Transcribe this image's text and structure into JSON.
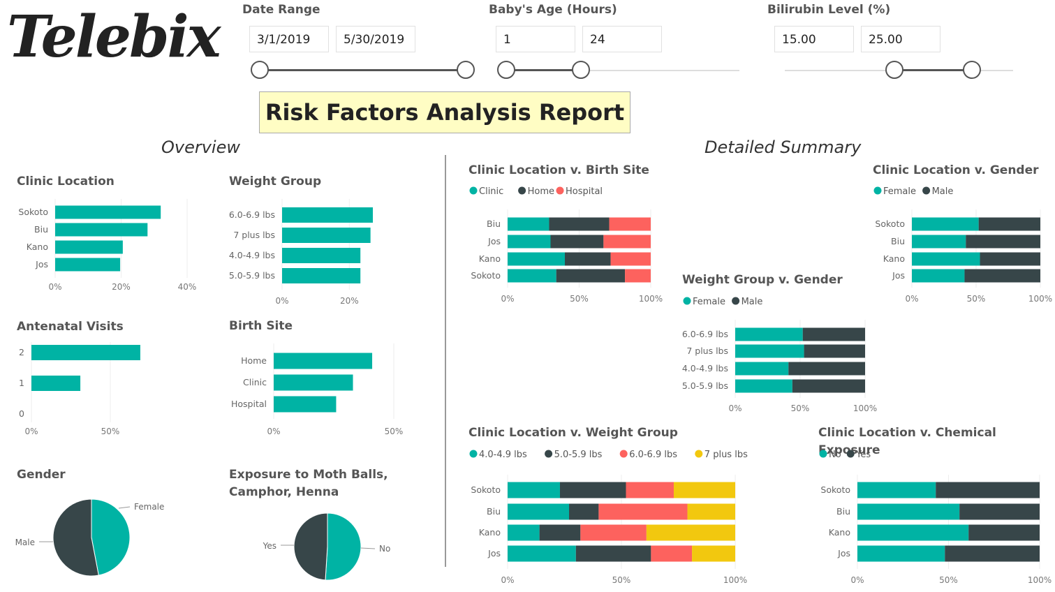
{
  "logo": {
    "text": "Telebix"
  },
  "report_title": "Risk Factors Analysis Report",
  "sections": {
    "overview": "Overview",
    "detailed": "Detailed Summary"
  },
  "slicers": {
    "date_range": {
      "title": "Date Range",
      "from": "3/1/2019",
      "to": "5/30/2019",
      "range_fraction": [
        0,
        1
      ]
    },
    "baby_age": {
      "title": "Baby's Age (Hours)",
      "from": "1",
      "to": "24",
      "range_fraction": [
        0,
        0.32
      ]
    },
    "bilirubin": {
      "title": "Bilirubin Level (%)",
      "from": "15.00",
      "to": "25.00",
      "range_fraction": [
        0.48,
        0.82
      ]
    }
  },
  "chart_data": [
    {
      "id": "clinic_location",
      "type": "bar",
      "title": "Clinic Location",
      "categories": [
        "Sokoto",
        "Biu",
        "Kano",
        "Jos"
      ],
      "values": [
        0.32,
        0.28,
        0.205,
        0.197
      ],
      "xticks": [
        {
          "v": 0,
          "label": "0%"
        },
        {
          "v": 0.2,
          "label": "20%"
        },
        {
          "v": 0.4,
          "label": "40%"
        }
      ],
      "xlim": [
        0,
        0.4
      ],
      "color": "#00b3a4"
    },
    {
      "id": "weight_group",
      "type": "bar",
      "title": "Weight Group",
      "categories": [
        "6.0-6.9 lbs",
        "7 plus lbs",
        "4.0-4.9 lbs",
        "5.0-5.9 lbs"
      ],
      "values": [
        0.27,
        0.263,
        0.233,
        0.233
      ],
      "xticks": [
        {
          "v": 0,
          "label": "0%"
        },
        {
          "v": 0.2,
          "label": "20%"
        }
      ],
      "xlim": [
        0,
        0.27
      ],
      "color": "#00b3a4"
    },
    {
      "id": "antenatal_visits",
      "type": "bar",
      "title": "Antenatal Visits",
      "categories": [
        "2",
        "1",
        "0"
      ],
      "values": [
        0.69,
        0.31,
        0
      ],
      "xticks": [
        {
          "v": 0,
          "label": "0%"
        },
        {
          "v": 0.5,
          "label": "50%"
        }
      ],
      "xlim": [
        0,
        0.5
      ],
      "color": "#00b3a4"
    },
    {
      "id": "birth_site",
      "type": "bar",
      "title": "Birth Site",
      "categories": [
        "Home",
        "Clinic",
        "Hospital"
      ],
      "values": [
        0.41,
        0.33,
        0.26
      ],
      "xticks": [
        {
          "v": 0,
          "label": "0%"
        },
        {
          "v": 0.5,
          "label": "50%"
        }
      ],
      "xlim": [
        0,
        0.5
      ],
      "color": "#00b3a4"
    },
    {
      "id": "gender",
      "type": "pie",
      "title": "Gender",
      "labels": [
        "Female",
        "Male"
      ],
      "values": [
        0.47,
        0.53
      ],
      "colors": [
        "#00b3a4",
        "#374649"
      ]
    },
    {
      "id": "exposure",
      "type": "pie",
      "title": "Exposure to Moth Balls, Camphor, Henna",
      "labels": [
        "No",
        "Yes"
      ],
      "values": [
        0.51,
        0.49
      ],
      "colors": [
        "#00b3a4",
        "#374649"
      ]
    },
    {
      "id": "clinic_v_birth_site",
      "type": "stacked_bar",
      "title": "Clinic Location v. Birth Site",
      "categories": [
        "Biu",
        "Jos",
        "Kano",
        "Sokoto"
      ],
      "series": [
        {
          "name": "Clinic",
          "color": "#00b3a4",
          "values": [
            0.29,
            0.3,
            0.4,
            0.34
          ]
        },
        {
          "name": "Home",
          "color": "#374649",
          "values": [
            0.42,
            0.37,
            0.32,
            0.48
          ]
        },
        {
          "name": "Hospital",
          "color": "#fd625e",
          "values": [
            0.29,
            0.33,
            0.28,
            0.18
          ]
        }
      ],
      "xticks": [
        {
          "v": 0,
          "label": "0%"
        },
        {
          "v": 0.5,
          "label": "50%"
        },
        {
          "v": 1,
          "label": "100%"
        }
      ]
    },
    {
      "id": "clinic_v_gender",
      "type": "stacked_bar",
      "title": "Clinic Location v. Gender",
      "categories": [
        "Sokoto",
        "Biu",
        "Kano",
        "Jos"
      ],
      "series": [
        {
          "name": "Female",
          "color": "#00b3a4",
          "values": [
            0.52,
            0.42,
            0.53,
            0.41
          ]
        },
        {
          "name": "Male",
          "color": "#374649",
          "values": [
            0.48,
            0.58,
            0.47,
            0.59
          ]
        }
      ],
      "xticks": [
        {
          "v": 0,
          "label": "0%"
        },
        {
          "v": 0.5,
          "label": "50%"
        },
        {
          "v": 1,
          "label": "100%"
        }
      ]
    },
    {
      "id": "weight_v_gender",
      "type": "stacked_bar",
      "title": "Weight Group v. Gender",
      "categories": [
        "6.0-6.9 lbs",
        "7 plus lbs",
        "4.0-4.9 lbs",
        "5.0-5.9 lbs"
      ],
      "series": [
        {
          "name": "Female",
          "color": "#00b3a4",
          "values": [
            0.52,
            0.53,
            0.41,
            0.44
          ]
        },
        {
          "name": "Male",
          "color": "#374649",
          "values": [
            0.48,
            0.47,
            0.59,
            0.56
          ]
        }
      ],
      "xticks": [
        {
          "v": 0,
          "label": "0%"
        },
        {
          "v": 0.5,
          "label": "50%"
        },
        {
          "v": 1,
          "label": "100%"
        }
      ]
    },
    {
      "id": "clinic_v_weight",
      "type": "stacked_bar",
      "title": "Clinic Location v. Weight Group",
      "categories": [
        "Sokoto",
        "Biu",
        "Kano",
        "Jos"
      ],
      "series": [
        {
          "name": "4.0-4.9 lbs",
          "color": "#00b3a4",
          "values": [
            0.23,
            0.27,
            0.14,
            0.3
          ]
        },
        {
          "name": "5.0-5.9 lbs",
          "color": "#374649",
          "values": [
            0.29,
            0.13,
            0.18,
            0.33
          ]
        },
        {
          "name": "6.0-6.9 lbs",
          "color": "#fd625e",
          "values": [
            0.21,
            0.39,
            0.29,
            0.18
          ]
        },
        {
          "name": "7 plus lbs",
          "color": "#f2c80f",
          "values": [
            0.27,
            0.21,
            0.39,
            0.19
          ]
        }
      ],
      "xticks": [
        {
          "v": 0,
          "label": "0%"
        },
        {
          "v": 0.5,
          "label": "50%"
        },
        {
          "v": 1,
          "label": "100%"
        }
      ]
    },
    {
      "id": "clinic_v_chemical",
      "type": "stacked_bar",
      "title": "Clinic Location v. Chemical Exposure",
      "categories": [
        "Sokoto",
        "Biu",
        "Kano",
        "Jos"
      ],
      "series": [
        {
          "name": "No",
          "color": "#00b3a4",
          "values": [
            0.43,
            0.56,
            0.61,
            0.48
          ]
        },
        {
          "name": "Yes",
          "color": "#374649",
          "values": [
            0.57,
            0.44,
            0.39,
            0.52
          ]
        }
      ],
      "xticks": [
        {
          "v": 0,
          "label": "0%"
        },
        {
          "v": 0.5,
          "label": "50%"
        },
        {
          "v": 1,
          "label": "100%"
        }
      ]
    }
  ]
}
